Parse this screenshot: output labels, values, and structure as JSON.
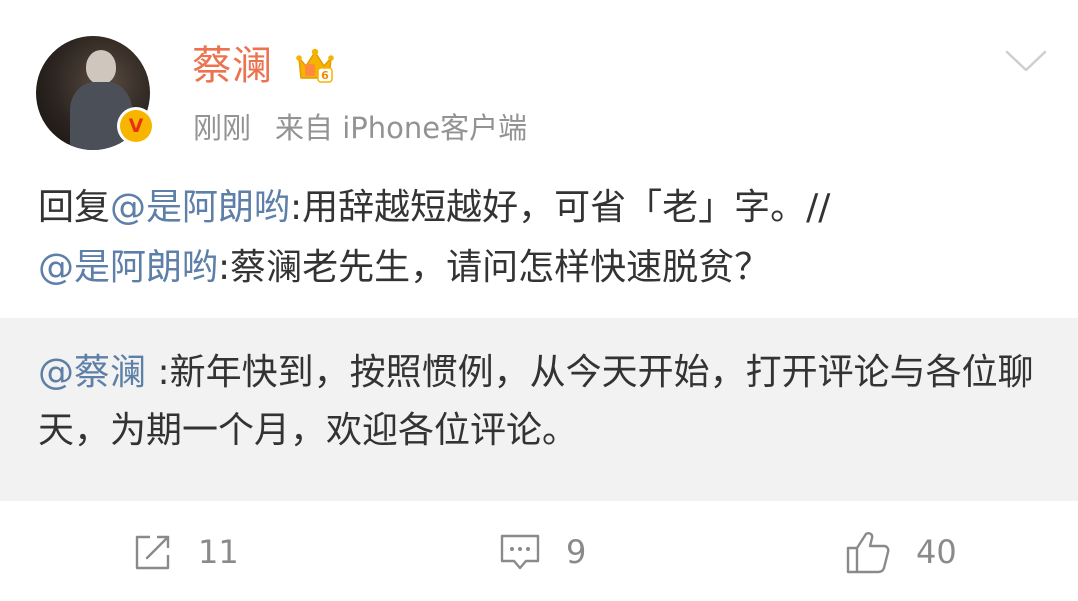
{
  "post": {
    "author": {
      "name": "蔡澜",
      "verified_badge_glyph": "V",
      "vip_badge_icon": "crown-vip-icon",
      "vip_level": "6"
    },
    "meta": {
      "time": "刚刚",
      "source": "来自 iPhone客户端"
    },
    "body": {
      "reply_prefix": "回复",
      "mention_1": "@是阿朗哟",
      "text_1": ":用辞越短越好，可省「老」字。//",
      "mention_2": "@是阿朗哟",
      "text_2": ":蔡澜老先生，请问怎样快速脱贫？"
    },
    "retweet": {
      "mention": "@蔡澜",
      "text": " :新年快到，按照惯例，从今天开始，打开评论与各位聊天，为期一个月，欢迎各位评论。"
    },
    "actions": {
      "repost_count": "11",
      "comment_count": "9",
      "like_count": "40"
    }
  },
  "colors": {
    "username": "#eb7350",
    "mention": "#5d7fa8",
    "meta": "#939393",
    "retweet_bg": "#f2f2f2",
    "action_icon": "#8a8a8a",
    "verified_badge": "#f7b500"
  }
}
